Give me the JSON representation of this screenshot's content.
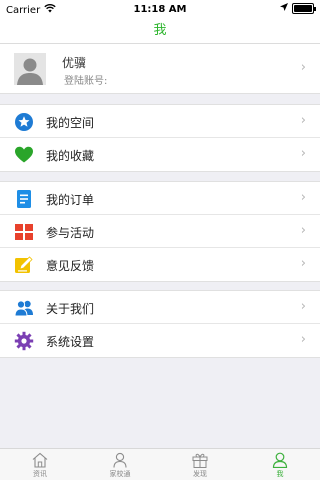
{
  "status_bar": {
    "carrier": "Carrier",
    "time": "11:18 AM"
  },
  "nav": {
    "title": "我"
  },
  "profile": {
    "name": "优骥",
    "login_label": "登陆账号:",
    "login_value": ""
  },
  "menu_groups": [
    {
      "items": [
        {
          "label": "我的空间",
          "icon": "star-badge-icon",
          "color": "#1e7bd4"
        },
        {
          "label": "我的收藏",
          "icon": "heart-icon",
          "color": "#2aa52a"
        }
      ]
    },
    {
      "items": [
        {
          "label": "我的订单",
          "icon": "document-icon",
          "color": "#1e8ee6"
        },
        {
          "label": "参与活动",
          "icon": "grid-icon",
          "color": "#e8412c"
        },
        {
          "label": "意见反馈",
          "icon": "edit-note-icon",
          "color": "#f2c200"
        }
      ]
    },
    {
      "items": [
        {
          "label": "关于我们",
          "icon": "people-icon",
          "color": "#1e7bd4"
        },
        {
          "label": "系统设置",
          "icon": "gear-icon",
          "color": "#7b3fb3"
        }
      ]
    }
  ],
  "tabs": [
    {
      "label": "资讯",
      "icon": "home-icon",
      "active": false
    },
    {
      "label": "家校通",
      "icon": "user-icon",
      "active": false
    },
    {
      "label": "发现",
      "icon": "gift-icon",
      "active": false
    },
    {
      "label": "我",
      "icon": "person-icon",
      "active": true
    }
  ],
  "colors": {
    "accent": "#2db52d",
    "background": "#efeff4"
  }
}
